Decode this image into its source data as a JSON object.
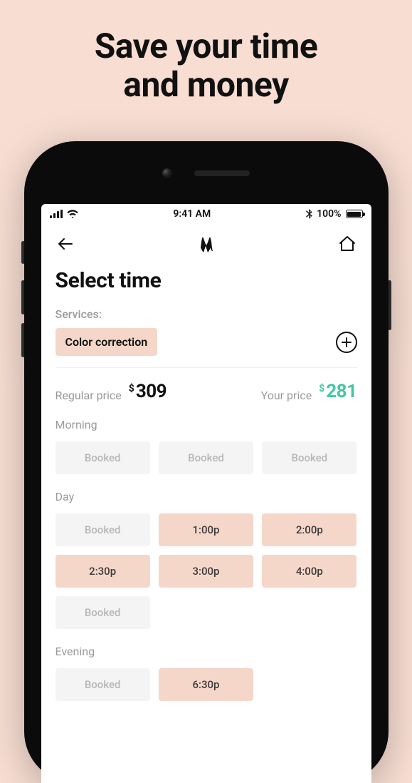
{
  "hero": {
    "line1": "Save your time",
    "line2": "and money"
  },
  "statusbar": {
    "time": "9:41 AM",
    "battery_pct": "100%"
  },
  "page": {
    "title": "Select time",
    "services_label": "Services:",
    "service_chip": "Color correction"
  },
  "pricing": {
    "regular_label": "Regular price",
    "regular_currency": "$",
    "regular_value": "309",
    "your_label": "Your price",
    "your_currency": "$",
    "your_value": "281"
  },
  "booked_label": "Booked",
  "sections": {
    "morning": {
      "label": "Morning",
      "slots": [
        {
          "text_key": "booked_label",
          "state": "booked"
        },
        {
          "text_key": "booked_label",
          "state": "booked"
        },
        {
          "text_key": "booked_label",
          "state": "booked"
        }
      ]
    },
    "day": {
      "label": "Day",
      "slots": [
        {
          "text_key": "booked_label",
          "state": "booked"
        },
        {
          "text": "1:00p",
          "state": "avail"
        },
        {
          "text": "2:00p",
          "state": "avail"
        },
        {
          "text": "2:30p",
          "state": "avail"
        },
        {
          "text": "3:00p",
          "state": "avail"
        },
        {
          "text": "4:00p",
          "state": "avail"
        },
        {
          "text_key": "booked_label",
          "state": "booked"
        }
      ]
    },
    "evening": {
      "label": "Evening",
      "slots": [
        {
          "text_key": "booked_label",
          "state": "booked"
        },
        {
          "text": "6:30p",
          "state": "avail"
        }
      ]
    }
  }
}
